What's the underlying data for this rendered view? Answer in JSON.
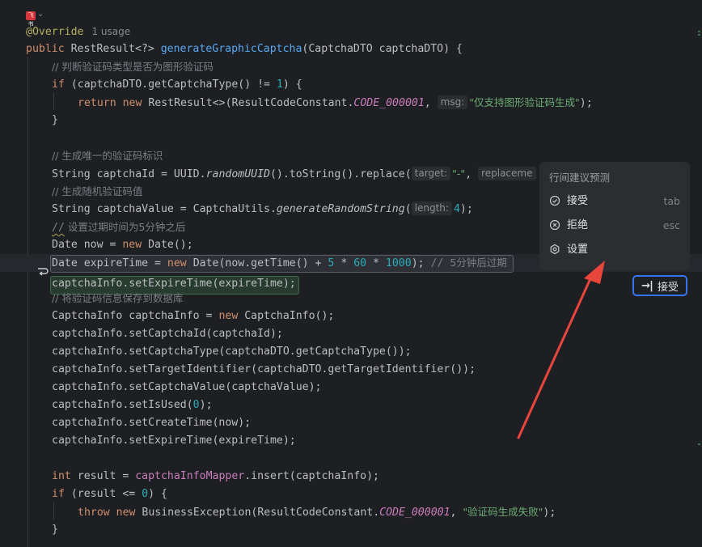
{
  "top_icon_label": "飞书",
  "code": {
    "override": "@Override",
    "usage": "1 usage",
    "sig_public": "public ",
    "sig_type": "RestResult<?> ",
    "sig_fn": "generateGraphicCaptcha",
    "sig_rest": "(CaptchaDTO captchaDTO) {",
    "c1": "// 判断验证码类型是否为图形验证码",
    "l_if1_kw": "if ",
    "l_if1_a": "(captchaDTO.getCaptchaType() != ",
    "l_if1_num": "1",
    "l_if1_b": ") {",
    "l_ret_kw1": "return ",
    "l_ret_kw2": "new ",
    "l_ret_a": "RestResult<>(ResultCodeConstant.",
    "l_ret_const": "CODE_000001",
    "l_ret_sep": ", ",
    "l_ret_hint": "msg:",
    "l_ret_str": "\"仅支持图形验证码生成\"",
    "l_ret_end": ");",
    "close1": "}",
    "c2": "// 生成唯一的验证码标识",
    "l_id_a": "String captchaId = UUID.",
    "l_id_it": "randomUUID",
    "l_id_b": "().toString().replace(",
    "l_id_hint1": "target:",
    "l_id_str": "\"-\"",
    "l_id_sep": ", ",
    "l_id_hint2": "replaceme",
    "c3": "// 生成随机验证码值",
    "l_val_a": "String captchaValue = CaptchaUtils.",
    "l_val_it": "generateRandomString",
    "l_val_b": "(",
    "l_val_hint": "length:",
    "l_val_num": "4",
    "l_val_end": ");",
    "c4_slashes": "//",
    "c4_text": " 设置过期时间为5分钟之后",
    "l_now_a": "Date now = ",
    "l_now_kw": "new ",
    "l_now_b": "Date();",
    "l_exp_a": "Date expireTime = ",
    "l_exp_kw": "new ",
    "l_exp_b": "Date(now.getTime() + ",
    "l_exp_n1": "5",
    "l_exp_m1": " * ",
    "l_exp_n2": "60",
    "l_exp_m2": " * ",
    "l_exp_n3": "1000",
    "l_exp_end": "); ",
    "l_exp_cm1": "// ",
    "l_exp_cm2": "5分钟后过期",
    "l_set_exp": "captchaInfo.setExpireTime(expireTime);",
    "c5": "// 将验证码信息保存到数据库",
    "l_ci_a": "CaptchaInfo captchaInfo = ",
    "l_ci_kw": "new ",
    "l_ci_b": "CaptchaInfo();",
    "l_s1": "captchaInfo.setCaptchaId(captchaId);",
    "l_s2": "captchaInfo.setCaptchaType(captchaDTO.getCaptchaType());",
    "l_s3": "captchaInfo.setTargetIdentifier(captchaDTO.getTargetIdentifier());",
    "l_s4": "captchaInfo.setCaptchaValue(captchaValue);",
    "l_s5_a": "captchaInfo.setIsUsed(",
    "l_s5_num": "0",
    "l_s5_b": ");",
    "l_s6": "captchaInfo.setCreateTime(now);",
    "l_s7": "captchaInfo.setExpireTime(expireTime);",
    "l_res_kw": "int ",
    "l_res_a": "result = ",
    "l_res_field": "captchaInfoMapper",
    "l_res_b": ".insert(captchaInfo);",
    "l_if2_kw": "if ",
    "l_if2_a": "(result <= ",
    "l_if2_num": "0",
    "l_if2_b": ") {",
    "l_thr_kw1": "throw ",
    "l_thr_kw2": "new ",
    "l_thr_a": "BusinessException(ResultCodeConstant.",
    "l_thr_const": "CODE_000001",
    "l_thr_sep": ", ",
    "l_thr_str": "\"验证码生成失败\"",
    "l_thr_end": ");",
    "close2": "}"
  },
  "popup": {
    "title": "行间建议预测",
    "items": [
      {
        "label": "接受",
        "shortcut": "tab",
        "icon": "check-circle-icon"
      },
      {
        "label": "拒绝",
        "shortcut": "esc",
        "icon": "x-circle-icon"
      },
      {
        "label": "设置",
        "shortcut": "",
        "icon": "gear-icon"
      }
    ]
  },
  "accept_button": {
    "icon_glyph": "→|",
    "label": "接受"
  },
  "colors": {
    "background": "#1e1f22",
    "keyword": "#cf8e6d",
    "function": "#56a8f5",
    "comment": "#7a7e85",
    "number": "#2aacb8",
    "string": "#6aab73",
    "constant": "#c77dbb",
    "accent": "#3574f0",
    "arrow": "#e8453c"
  }
}
